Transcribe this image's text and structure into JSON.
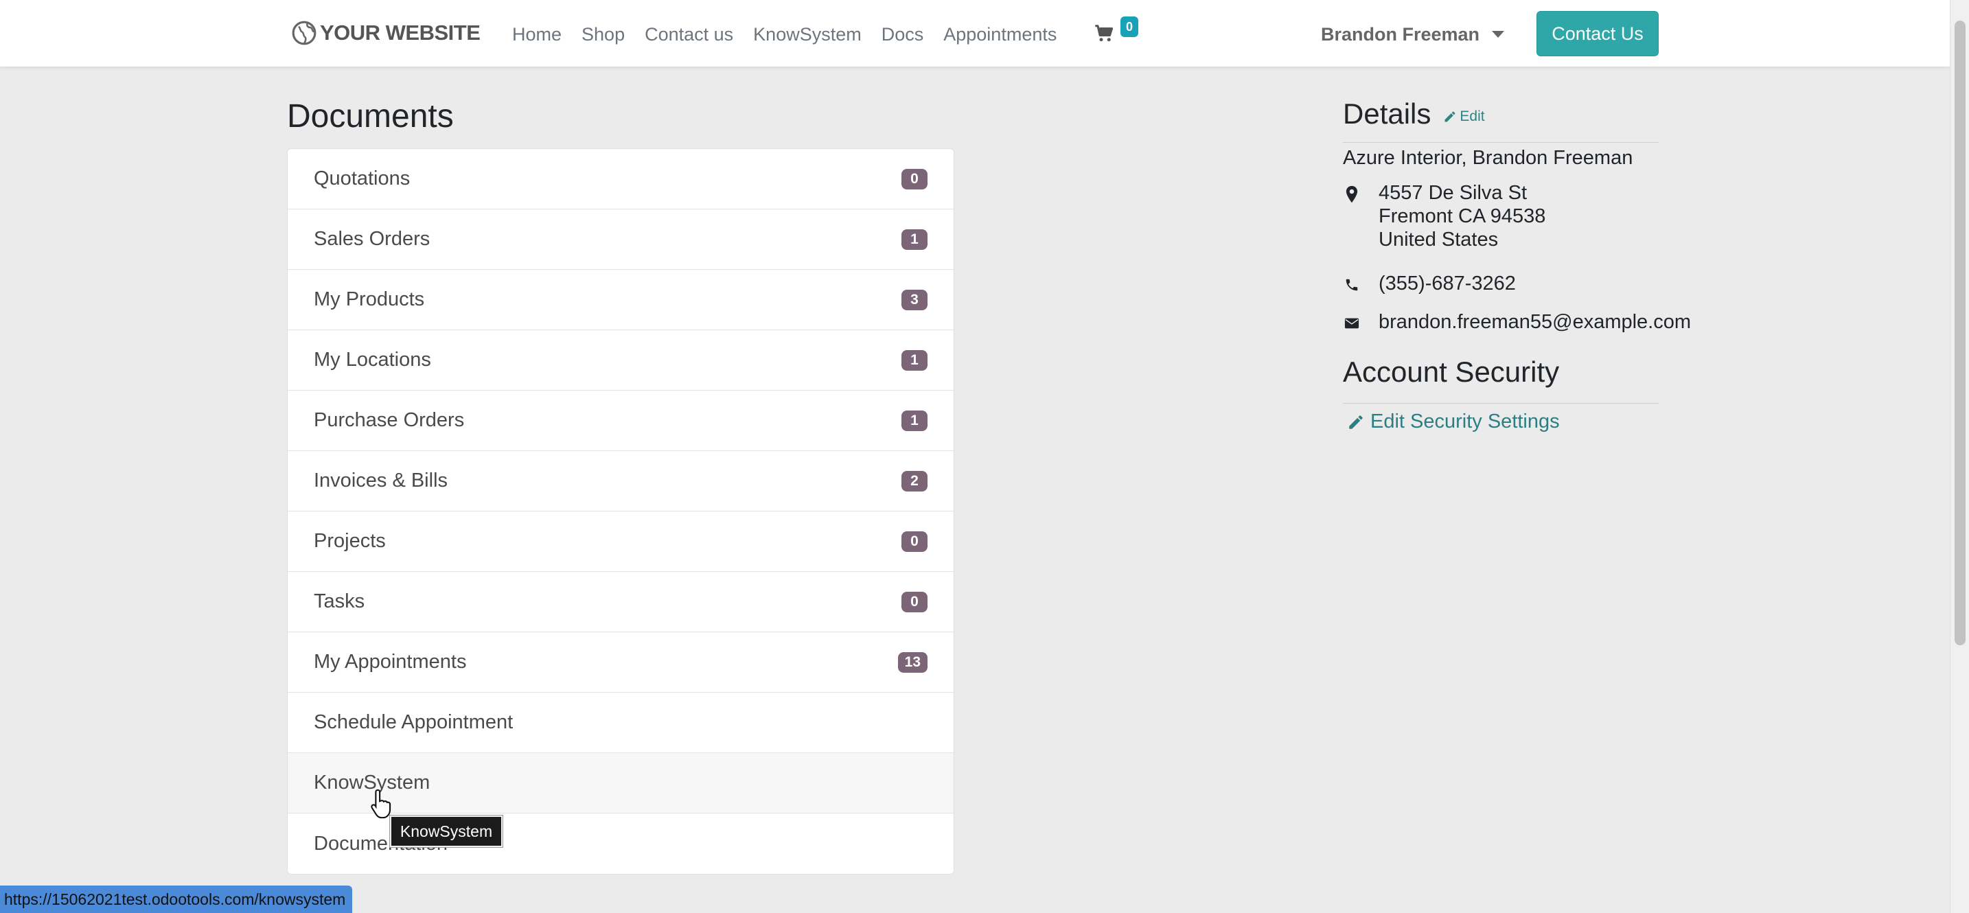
{
  "header": {
    "logo_text": "YOUR WEBSITE",
    "nav": [
      "Home",
      "Shop",
      "Contact us",
      "KnowSystem",
      "Docs",
      "Appointments"
    ],
    "cart_count": "0",
    "user_name": "Brandon Freeman",
    "contact_button": "Contact Us"
  },
  "documents": {
    "title": "Documents",
    "items": [
      {
        "label": "Quotations",
        "count": "0"
      },
      {
        "label": "Sales Orders",
        "count": "1"
      },
      {
        "label": "My Products",
        "count": "3"
      },
      {
        "label": "My Locations",
        "count": "1"
      },
      {
        "label": "Purchase Orders",
        "count": "1"
      },
      {
        "label": "Invoices & Bills",
        "count": "2"
      },
      {
        "label": "Projects",
        "count": "0"
      },
      {
        "label": "Tasks",
        "count": "0"
      },
      {
        "label": "My Appointments",
        "count": "13"
      },
      {
        "label": "Schedule Appointment"
      },
      {
        "label": "KnowSystem"
      },
      {
        "label": "Documentation"
      }
    ],
    "tooltip": "KnowSystem"
  },
  "details": {
    "title": "Details",
    "edit_label": "Edit",
    "company": "Azure Interior, Brandon Freeman",
    "address_line1": "4557 De Silva St",
    "address_line2": "Fremont CA 94538",
    "address_line3": "United States",
    "phone": "(355)-687-3262",
    "email": "brandon.freeman55@example.com"
  },
  "security": {
    "title": "Account Security",
    "link_label": "Edit Security Settings"
  },
  "status_bar": {
    "url": "https://15062021test.odootools.com/knowsystem"
  },
  "colors": {
    "accent": "#2fa6a8",
    "badge": "#7c6577",
    "link": "#2b8585"
  }
}
